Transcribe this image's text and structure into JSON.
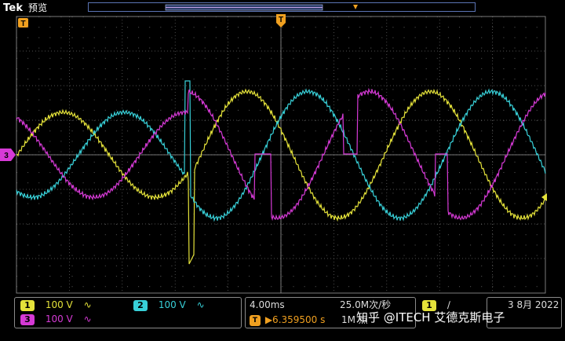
{
  "header": {
    "brand": "Tek",
    "mode": "预览"
  },
  "markers": {
    "trigger_position": "T",
    "trigger_level": "T",
    "ch3_ground": "3"
  },
  "colors": {
    "ch1": "#e4e23a",
    "ch2": "#38d0d8",
    "ch3": "#d63ad6",
    "trigger": "#f0a020",
    "grid": "#6a6a6a",
    "record_bar": "#5b74b4"
  },
  "channels": [
    {
      "id": "1",
      "scale": "100 V",
      "bandwidth": "∿",
      "color": "#e4e23a"
    },
    {
      "id": "2",
      "scale": "100 V",
      "bandwidth": "∿",
      "color": "#38d0d8"
    },
    {
      "id": "3",
      "scale": "100 V",
      "bandwidth": "∿",
      "color": "#d63ad6"
    }
  ],
  "timebase": {
    "scale": "4.00ms",
    "sample_rate": "25.0M次/秒",
    "record_length": "1M 点",
    "trigger_offset": "▶6.359500 s"
  },
  "trigger": {
    "source": "1",
    "slope": "∕"
  },
  "date": {
    "line1": "3 8月 2022",
    "line2": ""
  },
  "watermark": "知乎 @ITECH 艾德克斯电子"
}
